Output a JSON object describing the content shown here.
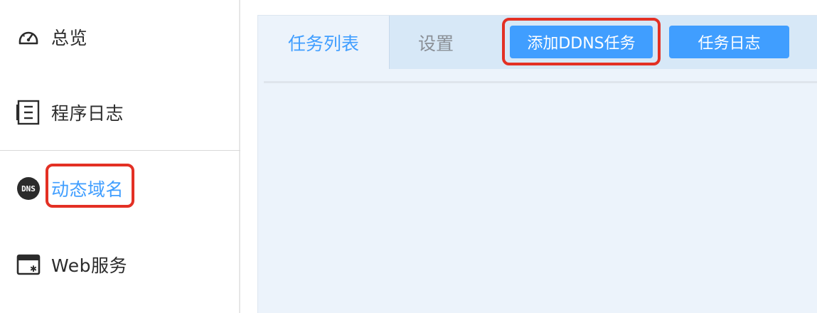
{
  "sidebar": {
    "items": [
      {
        "label": "总览",
        "icon": "dashboard-icon"
      },
      {
        "label": "程序日志",
        "icon": "log-document-icon"
      },
      {
        "label": "动态域名",
        "icon": "dns-icon"
      },
      {
        "label": "Web服务",
        "icon": "web-service-icon"
      }
    ]
  },
  "main": {
    "tabs": [
      {
        "label": "任务列表"
      },
      {
        "label": "设置"
      }
    ],
    "buttons": {
      "add_task": "添加DDNS任务",
      "task_log": "任务日志"
    }
  },
  "colors": {
    "accent": "#409eff",
    "highlight": "#e33024",
    "panel_bg": "#ecf3fb",
    "tabbar_bg": "#d7e8f7"
  }
}
